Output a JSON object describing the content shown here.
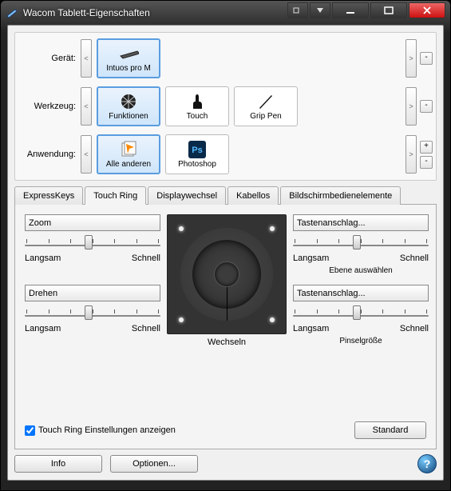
{
  "window": {
    "title": "Wacom Tablett-Eigenschaften"
  },
  "rows": {
    "device": {
      "label": "Gerät:",
      "items": [
        {
          "name": "Intuos pro M",
          "selected": true
        }
      ]
    },
    "tool": {
      "label": "Werkzeug:",
      "items": [
        {
          "name": "Funktionen",
          "selected": true
        },
        {
          "name": "Touch"
        },
        {
          "name": "Grip Pen"
        }
      ]
    },
    "app": {
      "label": "Anwendung:",
      "items": [
        {
          "name": "Alle anderen",
          "selected": true
        },
        {
          "name": "Photoshop"
        }
      ]
    }
  },
  "tabs": {
    "items": [
      "ExpressKeys",
      "Touch Ring",
      "Displaywechsel",
      "Kabellos",
      "Bildschirmbedienelemente"
    ],
    "active": "Touch Ring"
  },
  "ring": {
    "center_label": "Wechseln",
    "slider_labels": {
      "slow": "Langsam",
      "fast": "Schnell"
    },
    "functions": {
      "tl": {
        "value": "Zoom",
        "sub": ""
      },
      "tr": {
        "value": "Tastenanschlag...",
        "sub": "Ebene auswählen"
      },
      "bl": {
        "value": "Drehen",
        "sub": ""
      },
      "br": {
        "value": "Tastenanschlag...",
        "sub": "Pinselgröße"
      }
    },
    "show_settings": {
      "label": "Touch Ring Einstellungen anzeigen",
      "checked": true
    },
    "default_btn": "Standard"
  },
  "footer": {
    "info": "Info",
    "options": "Optionen..."
  },
  "glyph": {
    "left": "<",
    "right": ">",
    "plus": "+",
    "minus": "-",
    "help": "?"
  }
}
